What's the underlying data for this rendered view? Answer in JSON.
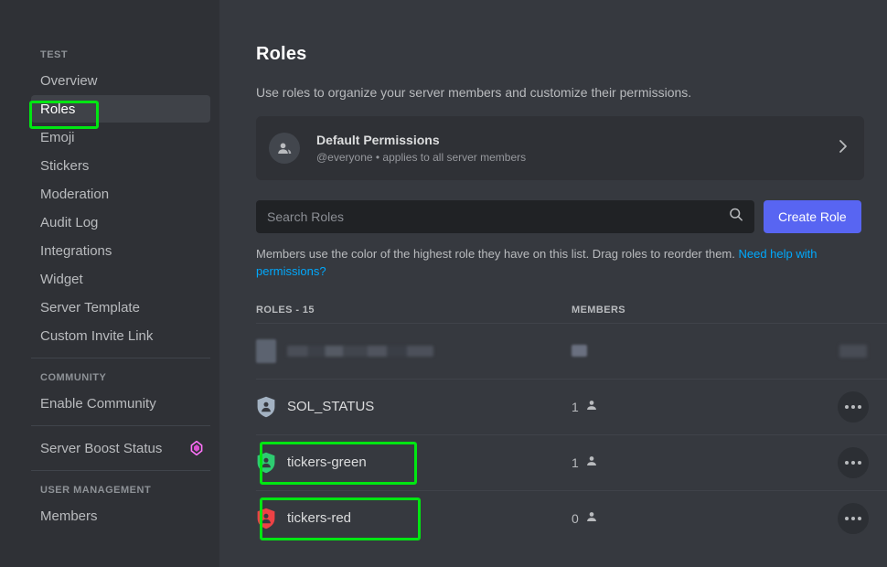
{
  "sidebar": {
    "sections": [
      {
        "heading": "TEST",
        "items": [
          {
            "label": "Overview",
            "active": false
          },
          {
            "label": "Roles",
            "active": true
          },
          {
            "label": "Emoji",
            "active": false
          },
          {
            "label": "Stickers",
            "active": false
          },
          {
            "label": "Moderation",
            "active": false
          },
          {
            "label": "Audit Log",
            "active": false
          },
          {
            "label": "Integrations",
            "active": false
          },
          {
            "label": "Widget",
            "active": false
          },
          {
            "label": "Server Template",
            "active": false
          },
          {
            "label": "Custom Invite Link",
            "active": false
          }
        ]
      },
      {
        "heading": "COMMUNITY",
        "items": [
          {
            "label": "Enable Community",
            "active": false
          }
        ]
      },
      {
        "heading": "",
        "items": [
          {
            "label": "Server Boost Status",
            "active": false,
            "icon": "server-boost-icon"
          }
        ]
      },
      {
        "heading": "USER MANAGEMENT",
        "items": [
          {
            "label": "Members",
            "active": false
          }
        ]
      }
    ]
  },
  "main": {
    "title": "Roles",
    "subtitle": "Use roles to organize your server members and customize their permissions.",
    "default_permissions": {
      "icon": "people-icon",
      "title": "Default Permissions",
      "description": "@everyone • applies to all server members",
      "chevron": "chevron-right-icon"
    },
    "search": {
      "placeholder": "Search Roles",
      "value": "",
      "icon": "search-icon"
    },
    "create_role_label": "Create Role",
    "hint_text": "Members use the color of the highest role they have on this list. Drag roles to reorder them. ",
    "hint_link": "Need help with permissions?",
    "table": {
      "col_roles_header": "ROLES - 15",
      "col_members_header": "MEMBERS",
      "rows": [
        {
          "name": "",
          "members": "",
          "redacted": true,
          "color": "#6b7280",
          "highlighted": false,
          "menu_icon": "more-options-icon"
        },
        {
          "name": "SOL_STATUS",
          "members": "1",
          "redacted": false,
          "color": "#a3b2c2",
          "highlighted": false,
          "menu_icon": "more-options-icon"
        },
        {
          "name": "tickers-green",
          "members": "1",
          "redacted": false,
          "color": "#2ecc71",
          "highlighted": true,
          "menu_icon": "more-options-icon"
        },
        {
          "name": "tickers-red",
          "members": "0",
          "redacted": false,
          "color": "#ed4245",
          "highlighted": true,
          "menu_icon": "more-options-icon"
        }
      ]
    }
  },
  "colors": {
    "sidebar_bg": "#2f3136",
    "main_bg": "#36393f",
    "accent_blurple": "#5865f2",
    "link_blue": "#00a8fc",
    "annotation_green": "#00e612",
    "boost_pink": "#ff73fa"
  }
}
